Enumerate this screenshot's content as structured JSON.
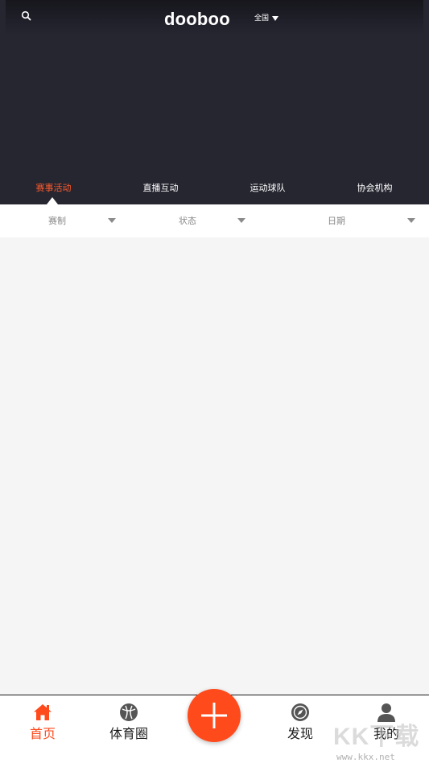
{
  "header": {
    "logo": "dooboo",
    "region_label": "全国"
  },
  "tabs": [
    {
      "label": "赛事活动",
      "active": true
    },
    {
      "label": "直播互动",
      "active": false
    },
    {
      "label": "运动球队",
      "active": false
    },
    {
      "label": "协会机构",
      "active": false
    }
  ],
  "filters": [
    {
      "label": "赛制"
    },
    {
      "label": "状态"
    },
    {
      "label": "日期"
    }
  ],
  "bottom_nav": [
    {
      "label": "首页",
      "icon": "home-icon",
      "active": true
    },
    {
      "label": "体育圈",
      "icon": "ball-icon",
      "active": false
    },
    {
      "label": "",
      "icon": "plus-icon",
      "active": false
    },
    {
      "label": "发现",
      "icon": "compass-icon",
      "active": false
    },
    {
      "label": "我的",
      "icon": "person-icon",
      "active": false
    }
  ],
  "watermark": {
    "text": "KK下载",
    "url": "www.kkx.net"
  },
  "colors": {
    "header_bg": "#262631",
    "accent": "#ff4a1c",
    "active_tab": "#ff5a2b",
    "content_bg": "#f5f5f5"
  }
}
